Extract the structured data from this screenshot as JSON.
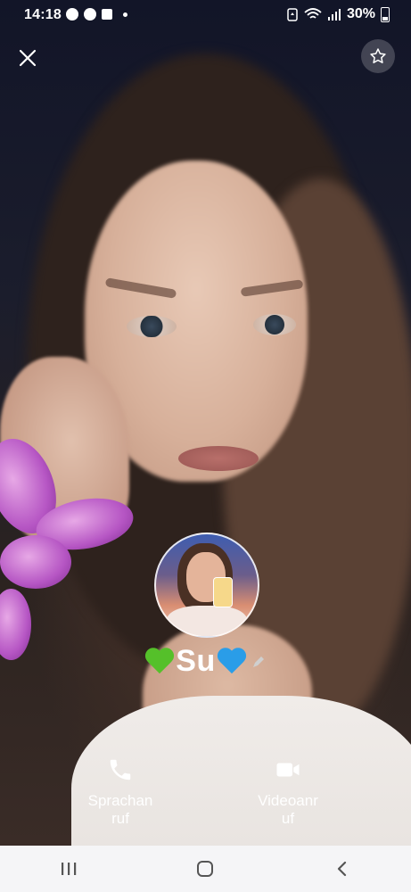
{
  "status_bar": {
    "time": "14:18",
    "battery_percent": "30%",
    "notification_icons": [
      "messenger-icon",
      "messenger-icon",
      "gallery-icon",
      "dot-icon"
    ],
    "system_icons": [
      "battery-saver-icon",
      "wifi-icon",
      "signal-icon",
      "battery-icon"
    ]
  },
  "header": {
    "close_icon": "close-icon",
    "favorite_icon": "star-outline-icon"
  },
  "profile": {
    "name_emoji_left": "💚",
    "name_text": "Su",
    "name_emoji_right": "💙",
    "edit_icon": "pencil-icon"
  },
  "actions": {
    "voice_call_label": "Sprachan\nruf",
    "video_call_label": "Videoanr\nuf"
  },
  "nav": {
    "recents_icon": "recents-icon",
    "home_icon": "home-icon",
    "back_icon": "back-icon"
  },
  "colors": {
    "nav_bg": "#f5f5f7",
    "nav_icon": "#555555",
    "text": "#ffffff",
    "heart_green": "#55c02a",
    "heart_blue": "#2a9de8"
  }
}
